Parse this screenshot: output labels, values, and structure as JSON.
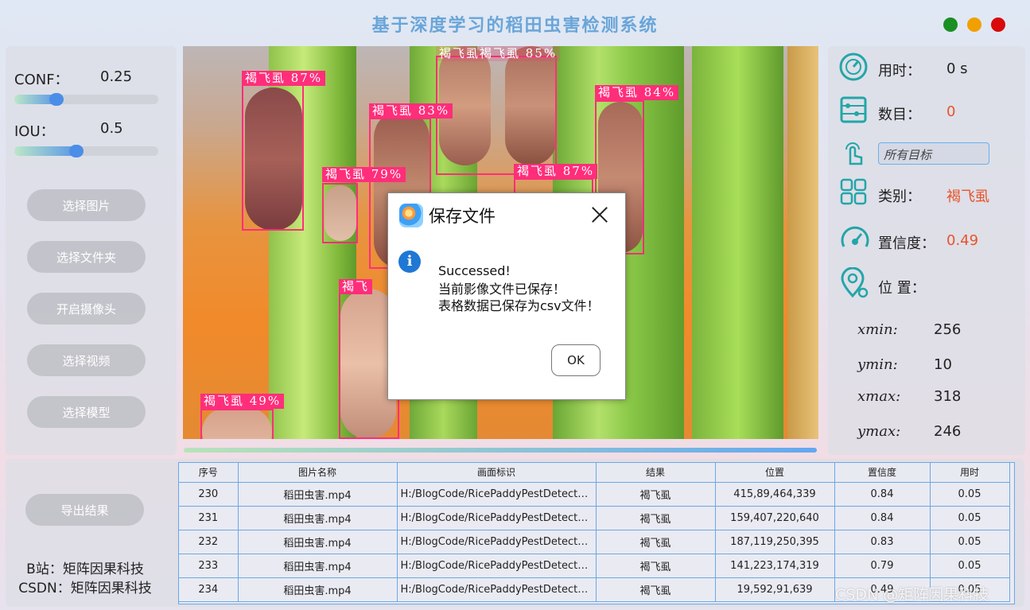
{
  "app": {
    "title": "基于深度学习的稻田虫害检测系统"
  },
  "colors": {
    "accent": "#5a98e6",
    "detection": "#ff2e7a",
    "highlight": "#e8542a",
    "min": "#1a8f24",
    "max": "#f0a000",
    "close": "#d80a0a"
  },
  "params": {
    "conf_label": "CONF：",
    "conf_value": "0.25",
    "conf_level": 0.25,
    "iou_label": "IOU：",
    "iou_value": "0.5",
    "iou_level": 0.5
  },
  "buttons": {
    "select_image": "选择图片",
    "select_folder": "选择文件夹",
    "open_camera": "开启摄像头",
    "select_video": "选择视频",
    "select_model": "选择模型",
    "export": "导出结果"
  },
  "detections": [
    {
      "label": "褐飞虱 87%"
    },
    {
      "label": "褐飞虱 83%"
    },
    {
      "label": "褐飞虱褐飞虱 85%"
    },
    {
      "label": "褐飞虱 84%"
    },
    {
      "label": "褐飞虱 79%"
    },
    {
      "label": "褐飞虱 87%"
    },
    {
      "label": "褐飞"
    },
    {
      "label": "褐飞虱 49%"
    }
  ],
  "dialog": {
    "title": "保存文件",
    "line1": "Successed!",
    "line2": "当前影像文件已保存！",
    "line3": "表格数据已保存为csv文件！",
    "ok": "OK"
  },
  "info": {
    "time_label": "用时：",
    "time_value": "0 s",
    "count_label": "数目：",
    "count_value": "0",
    "target_select": "所有目标",
    "class_label": "类别：",
    "class_value": "褐飞虱",
    "conf_label": "置信度：",
    "conf_value": "0.49",
    "pos_label": "位 置：",
    "xmin_label": "xmin:",
    "xmin_value": "256",
    "ymin_label": "ymin:",
    "ymin_value": "10",
    "xmax_label": "xmax:",
    "xmax_value": "318",
    "ymax_label": "ymax:",
    "ymax_value": "246"
  },
  "credits": {
    "bilibili": "B站：矩阵因果科技",
    "csdn": "CSDN：矩阵因果科技"
  },
  "table": {
    "headers": [
      "序号",
      "图片名称",
      "画面标识",
      "结果",
      "位置",
      "置信度",
      "用时"
    ],
    "rows": [
      [
        "230",
        "稻田虫害.mp4",
        "H:/BlogCode/RicePaddyPestDetector...",
        "褐飞虱",
        "415,89,464,339",
        "0.84",
        "0.05"
      ],
      [
        "231",
        "稻田虫害.mp4",
        "H:/BlogCode/RicePaddyPestDetector...",
        "褐飞虱",
        "159,407,220,640",
        "0.84",
        "0.05"
      ],
      [
        "232",
        "稻田虫害.mp4",
        "H:/BlogCode/RicePaddyPestDetector...",
        "褐飞虱",
        "187,119,250,395",
        "0.83",
        "0.05"
      ],
      [
        "233",
        "稻田虫害.mp4",
        "H:/BlogCode/RicePaddyPestDetector...",
        "褐飞虱",
        "141,223,174,319",
        "0.79",
        "0.05"
      ],
      [
        "234",
        "稻田虫害.mp4",
        "H:/BlogCode/RicePaddyPestDetector...",
        "褐飞虱",
        "19,592,91,639",
        "0.49",
        "0.05"
      ]
    ]
  },
  "watermark": "CSDN @矩阵因果科技"
}
